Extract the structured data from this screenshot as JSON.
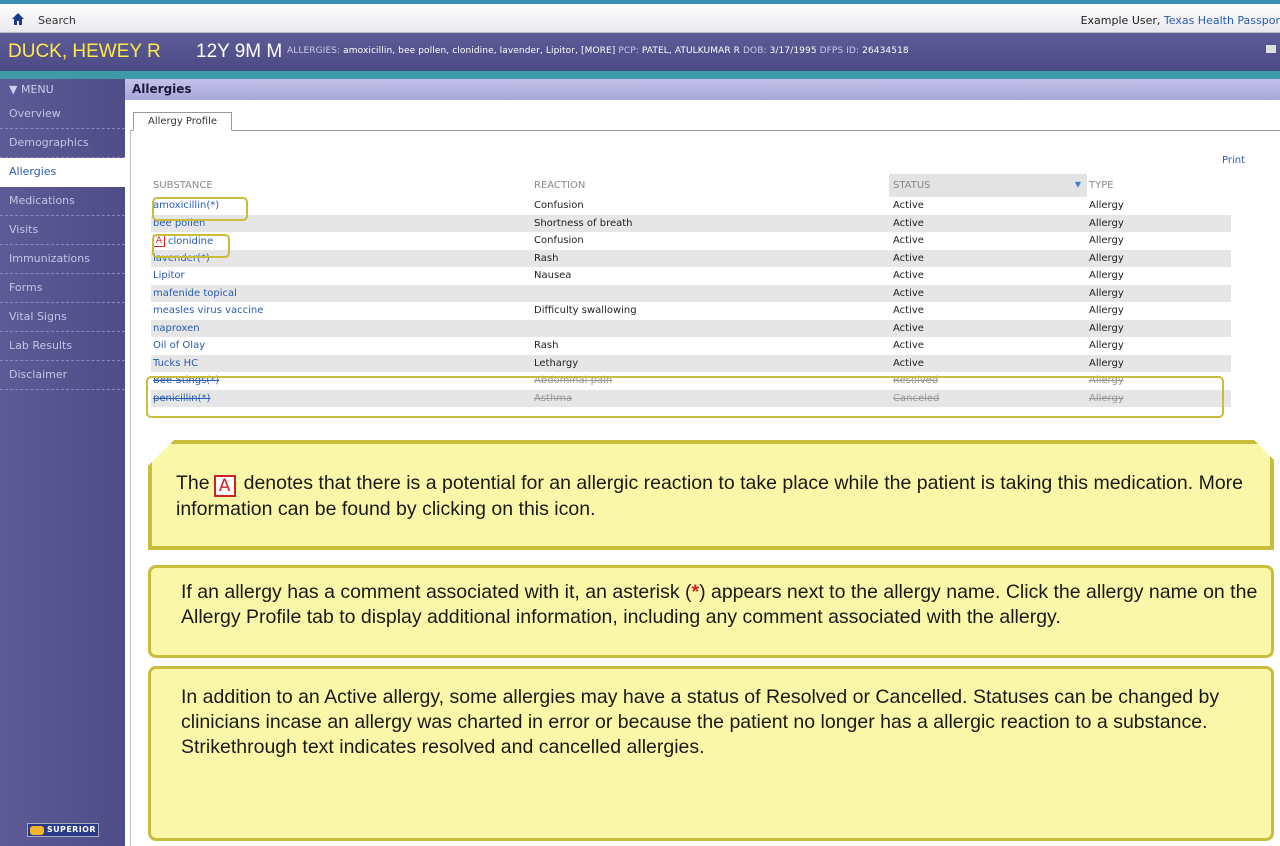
{
  "topbar": {
    "home_icon": "home-icon",
    "search_label": "Search",
    "user_name": "Example User,",
    "organization": "Texas Health Passpor"
  },
  "patient": {
    "name": "DUCK, HEWEY R",
    "age_sex": "12Y 9M  M",
    "allergies_label": "ALLERGIES:",
    "allergies_value": "amoxicillin, bee pollen, clonidine, lavender, Lipitor, [MORE]",
    "pcp_label": "PCP:",
    "pcp_value": "PATEL, ATULKUMAR R",
    "dob_label": "DOB:",
    "dob_value": "3/17/1995",
    "dfps_label": "DFPS ID:",
    "dfps_value": "26434518"
  },
  "sidebar": {
    "menu_label": "▼ MENU",
    "items": [
      {
        "label": "Overview"
      },
      {
        "label": "Demographics"
      },
      {
        "label": "Allergies"
      },
      {
        "label": "Medications"
      },
      {
        "label": "Visits"
      },
      {
        "label": "Immunizations"
      },
      {
        "label": "Forms"
      },
      {
        "label": "Vital Signs"
      },
      {
        "label": "Lab Results"
      },
      {
        "label": "Disclaimer"
      }
    ],
    "active_item": "Allergies",
    "logo_text": "SUPERIOR"
  },
  "main": {
    "section_title": "Allergies",
    "tab_label": "Allergy Profile",
    "print_label": "Print",
    "columns": [
      "SUBSTANCE",
      "REACTION",
      "STATUS",
      "TYPE"
    ],
    "sort_indicator": "▼",
    "rows": [
      {
        "substance": "amoxicillin(*)",
        "reaction": "Confusion",
        "status": "Active",
        "type": "Allergy"
      },
      {
        "substance": "bee pollen",
        "reaction": "Shortness of breath",
        "status": "Active",
        "type": "Allergy"
      },
      {
        "substance": "clonidine",
        "reaction": "Confusion",
        "status": "Active",
        "type": "Allergy"
      },
      {
        "substance": "lavender(*)",
        "reaction": "Rash",
        "status": "Active",
        "type": "Allergy"
      },
      {
        "substance": "Lipitor",
        "reaction": "Nausea",
        "status": "Active",
        "type": "Allergy"
      },
      {
        "substance": "mafenide topical",
        "reaction": "",
        "status": "Active",
        "type": "Allergy"
      },
      {
        "substance": "measles virus vaccine",
        "reaction": "Difficulty swallowing",
        "status": "Active",
        "type": "Allergy"
      },
      {
        "substance": "naproxen",
        "reaction": "",
        "status": "Active",
        "type": "Allergy"
      },
      {
        "substance": "Oil of Olay",
        "reaction": "Rash",
        "status": "Active",
        "type": "Allergy"
      },
      {
        "substance": "Tucks HC",
        "reaction": "Lethargy",
        "status": "Active",
        "type": "Allergy"
      },
      {
        "substance": "Bee Stings(*)",
        "reaction": "Abdominal pain",
        "status": "Resolved",
        "type": "Allergy"
      },
      {
        "substance": "penicillin(*)",
        "reaction": "Asthma",
        "status": "Canceled",
        "type": "Allergy"
      }
    ],
    "alert_icon_letter": "A"
  },
  "callouts": {
    "c1_before": "The",
    "c1_icon_letter": "A",
    "c1_after": "denotes that there is a potential for an allergic reaction to take place while the patient is taking this medication.  More information can be found by clicking on this icon.",
    "c2_part1": "If an allergy has a comment associated with it, an asterisk (",
    "c2_asterisk": "*",
    "c2_part2": ") appears next to the allergy name. Click the allergy name on the Allergy Profile tab to display additional information, including any comment associated with the allergy.",
    "c3_text": "In addition to an Active allergy, some allergies may have a status of Resolved or Cancelled.  Statuses can be changed by clinicians incase an allergy was charted in error or because the patient no longer has a allergic reaction to a substance.  Strikethrough text indicates resolved and cancelled allergies."
  },
  "colors": {
    "accent": "#2a5bb0",
    "header_bg": "#4f4d88",
    "patient_name": "#ffe94a",
    "callout_bg": "#fbf7a8",
    "callout_border": "#c8be3c",
    "alert_red": "#d02020"
  }
}
